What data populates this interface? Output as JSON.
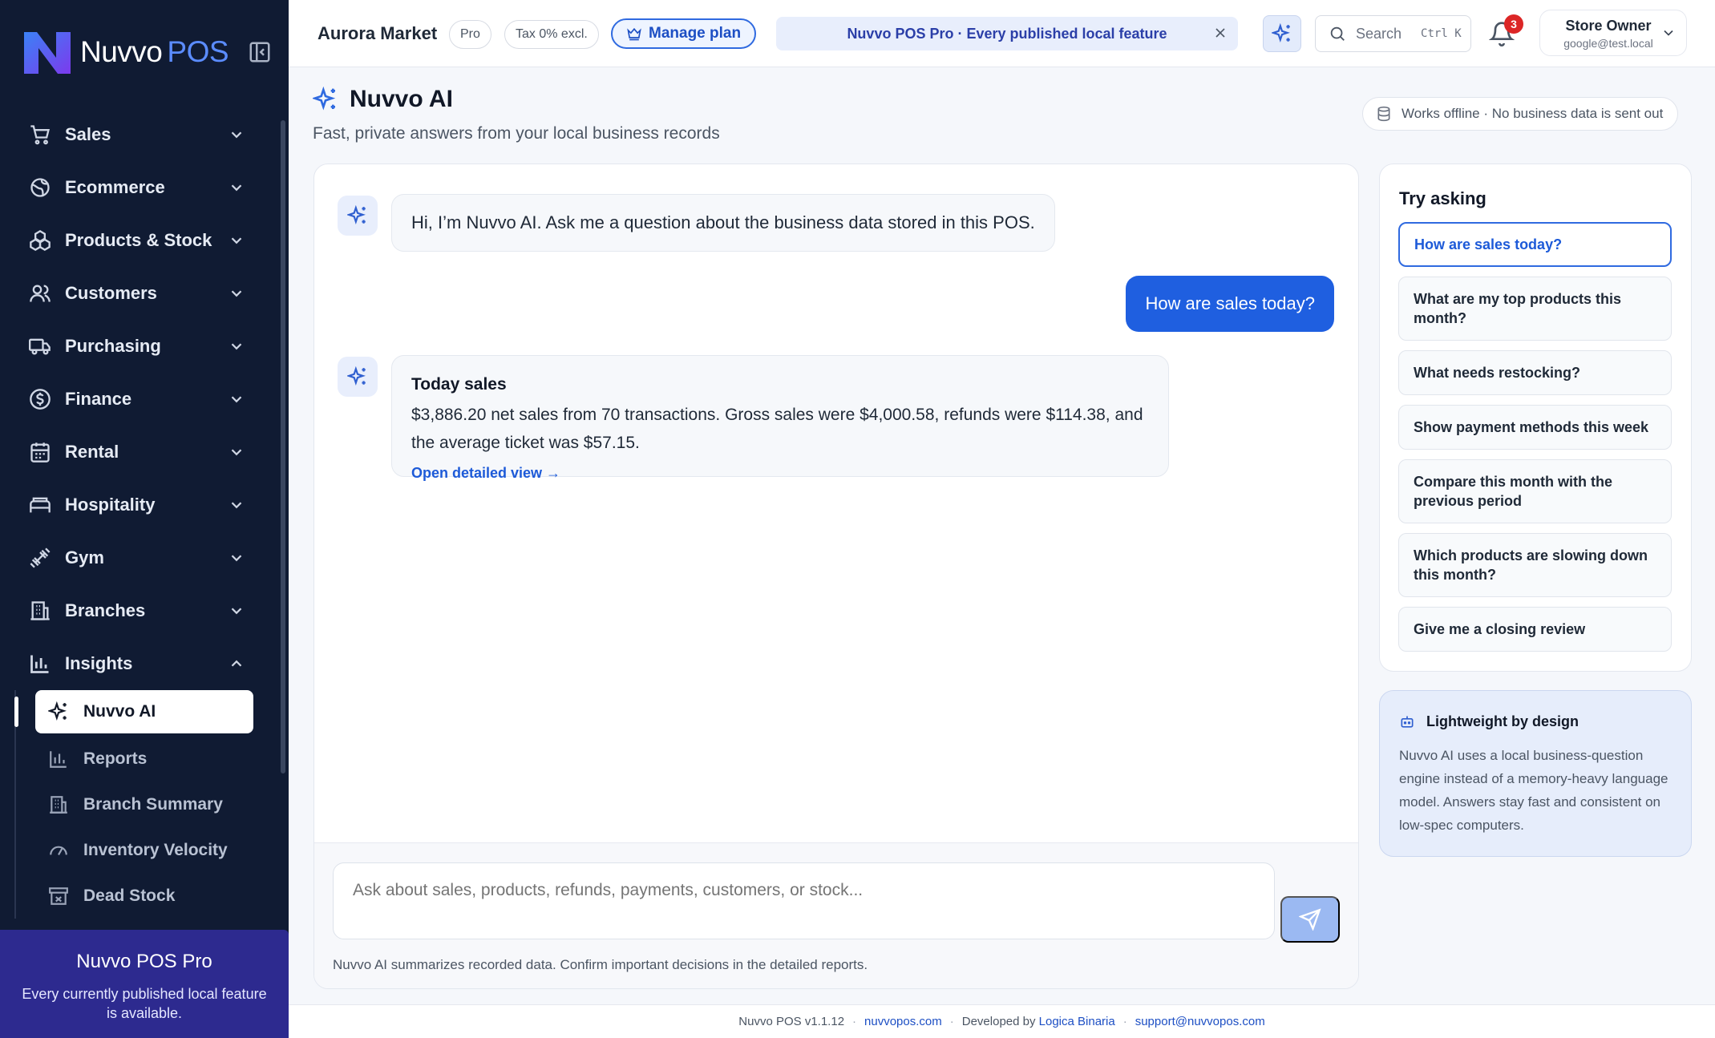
{
  "brand": {
    "name_a": "Nuvvo",
    "name_b": "POS"
  },
  "sidebar": {
    "items": [
      {
        "label": "Sales",
        "icon": "cart-icon"
      },
      {
        "label": "Ecommerce",
        "icon": "globe-icon"
      },
      {
        "label": "Products & Stock",
        "icon": "boxes-icon"
      },
      {
        "label": "Customers",
        "icon": "users-icon"
      },
      {
        "label": "Purchasing",
        "icon": "truck-icon"
      },
      {
        "label": "Finance",
        "icon": "dollar-icon"
      },
      {
        "label": "Rental",
        "icon": "calendar-icon"
      },
      {
        "label": "Hospitality",
        "icon": "bed-icon"
      },
      {
        "label": "Gym",
        "icon": "dumbbell-icon"
      },
      {
        "label": "Branches",
        "icon": "building-icon"
      },
      {
        "label": "Insights",
        "icon": "bar-chart-icon"
      }
    ],
    "insights_sub": [
      {
        "label": "Nuvvo AI",
        "icon": "sparkles-icon",
        "active": true
      },
      {
        "label": "Reports",
        "icon": "bar-chart-icon"
      },
      {
        "label": "Branch Summary",
        "icon": "building-icon"
      },
      {
        "label": "Inventory Velocity",
        "icon": "gauge-icon"
      },
      {
        "label": "Dead Stock",
        "icon": "archive-icon"
      }
    ],
    "promo": {
      "title": "Nuvvo POS Pro",
      "text": "Every currently published local feature is available."
    }
  },
  "header": {
    "store": "Aurora Market",
    "plan_badge": "Pro",
    "tax_badge": "Tax 0% excl.",
    "manage_plan": "Manage plan",
    "banner": "Nuvvo POS Pro · Every published local feature",
    "search_placeholder": "Search",
    "search_shortcut": "Ctrl K",
    "notifications": "3",
    "user_name": "Store Owner",
    "user_email": "google@test.local"
  },
  "page": {
    "title": "Nuvvo AI",
    "subtitle": "Fast, private answers from your local business records",
    "offline_note": "Works offline · No business data is sent out"
  },
  "chat": {
    "greeting": "Hi, I’m Nuvvo AI. Ask me a question about the business data stored in this POS.",
    "user_message": "How are sales today?",
    "answer_title": "Today sales",
    "answer_body": "$3,886.20 net sales from 70 transactions. Gross sales were $4,000.58, refunds were $114.38, and the average ticket was $57.15.",
    "answer_link": "Open detailed view →",
    "input_placeholder": "Ask about sales, products, refunds, payments, customers, or stock...",
    "disclaimer": "Nuvvo AI summarizes recorded data. Confirm important decisions in the detailed reports."
  },
  "try_asking": {
    "title": "Try asking",
    "suggestions": [
      "How are sales today?",
      "What are my top products this month?",
      "What needs restocking?",
      "Show payment methods this week",
      "Compare this month with the previous period",
      "Which products are slowing down this month?",
      "Give me a closing review"
    ]
  },
  "lightweight": {
    "title": "Lightweight by design",
    "body": "Nuvvo AI uses a local business-question engine instead of a memory-heavy language model. Answers stay fast and consistent on low-spec computers."
  },
  "footer": {
    "version": "Nuvvo POS v1.1.12",
    "site": "nuvvopos.com",
    "dev_prefix": "Developed by",
    "dev_name": "Logica Binaria",
    "support": "support@nuvvopos.com"
  },
  "colors": {
    "sidebar_bg": "#101b33",
    "accent": "#1f5fe0",
    "promo_bg": "#2d2a8f",
    "badge_red": "#dc2626"
  }
}
